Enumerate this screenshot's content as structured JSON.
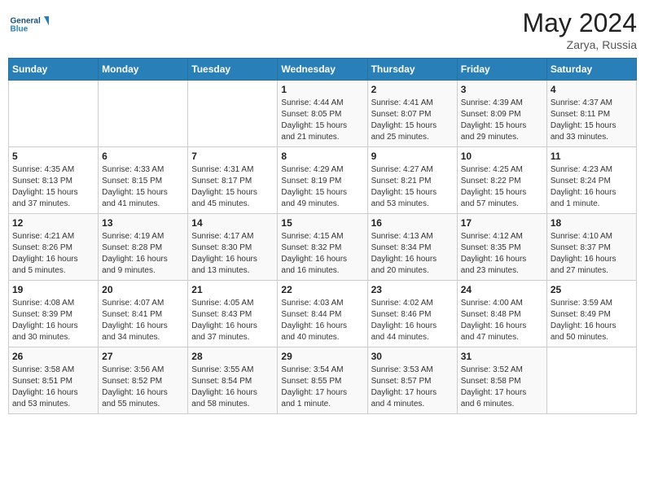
{
  "logo": {
    "line1": "General",
    "line2": "Blue"
  },
  "title": "May 2024",
  "location": "Zarya, Russia",
  "days_header": [
    "Sunday",
    "Monday",
    "Tuesday",
    "Wednesday",
    "Thursday",
    "Friday",
    "Saturday"
  ],
  "weeks": [
    [
      {
        "day": "",
        "info": ""
      },
      {
        "day": "",
        "info": ""
      },
      {
        "day": "",
        "info": ""
      },
      {
        "day": "1",
        "info": "Sunrise: 4:44 AM\nSunset: 8:05 PM\nDaylight: 15 hours\nand 21 minutes."
      },
      {
        "day": "2",
        "info": "Sunrise: 4:41 AM\nSunset: 8:07 PM\nDaylight: 15 hours\nand 25 minutes."
      },
      {
        "day": "3",
        "info": "Sunrise: 4:39 AM\nSunset: 8:09 PM\nDaylight: 15 hours\nand 29 minutes."
      },
      {
        "day": "4",
        "info": "Sunrise: 4:37 AM\nSunset: 8:11 PM\nDaylight: 15 hours\nand 33 minutes."
      }
    ],
    [
      {
        "day": "5",
        "info": "Sunrise: 4:35 AM\nSunset: 8:13 PM\nDaylight: 15 hours\nand 37 minutes."
      },
      {
        "day": "6",
        "info": "Sunrise: 4:33 AM\nSunset: 8:15 PM\nDaylight: 15 hours\nand 41 minutes."
      },
      {
        "day": "7",
        "info": "Sunrise: 4:31 AM\nSunset: 8:17 PM\nDaylight: 15 hours\nand 45 minutes."
      },
      {
        "day": "8",
        "info": "Sunrise: 4:29 AM\nSunset: 8:19 PM\nDaylight: 15 hours\nand 49 minutes."
      },
      {
        "day": "9",
        "info": "Sunrise: 4:27 AM\nSunset: 8:21 PM\nDaylight: 15 hours\nand 53 minutes."
      },
      {
        "day": "10",
        "info": "Sunrise: 4:25 AM\nSunset: 8:22 PM\nDaylight: 15 hours\nand 57 minutes."
      },
      {
        "day": "11",
        "info": "Sunrise: 4:23 AM\nSunset: 8:24 PM\nDaylight: 16 hours\nand 1 minute."
      }
    ],
    [
      {
        "day": "12",
        "info": "Sunrise: 4:21 AM\nSunset: 8:26 PM\nDaylight: 16 hours\nand 5 minutes."
      },
      {
        "day": "13",
        "info": "Sunrise: 4:19 AM\nSunset: 8:28 PM\nDaylight: 16 hours\nand 9 minutes."
      },
      {
        "day": "14",
        "info": "Sunrise: 4:17 AM\nSunset: 8:30 PM\nDaylight: 16 hours\nand 13 minutes."
      },
      {
        "day": "15",
        "info": "Sunrise: 4:15 AM\nSunset: 8:32 PM\nDaylight: 16 hours\nand 16 minutes."
      },
      {
        "day": "16",
        "info": "Sunrise: 4:13 AM\nSunset: 8:34 PM\nDaylight: 16 hours\nand 20 minutes."
      },
      {
        "day": "17",
        "info": "Sunrise: 4:12 AM\nSunset: 8:35 PM\nDaylight: 16 hours\nand 23 minutes."
      },
      {
        "day": "18",
        "info": "Sunrise: 4:10 AM\nSunset: 8:37 PM\nDaylight: 16 hours\nand 27 minutes."
      }
    ],
    [
      {
        "day": "19",
        "info": "Sunrise: 4:08 AM\nSunset: 8:39 PM\nDaylight: 16 hours\nand 30 minutes."
      },
      {
        "day": "20",
        "info": "Sunrise: 4:07 AM\nSunset: 8:41 PM\nDaylight: 16 hours\nand 34 minutes."
      },
      {
        "day": "21",
        "info": "Sunrise: 4:05 AM\nSunset: 8:43 PM\nDaylight: 16 hours\nand 37 minutes."
      },
      {
        "day": "22",
        "info": "Sunrise: 4:03 AM\nSunset: 8:44 PM\nDaylight: 16 hours\nand 40 minutes."
      },
      {
        "day": "23",
        "info": "Sunrise: 4:02 AM\nSunset: 8:46 PM\nDaylight: 16 hours\nand 44 minutes."
      },
      {
        "day": "24",
        "info": "Sunrise: 4:00 AM\nSunset: 8:48 PM\nDaylight: 16 hours\nand 47 minutes."
      },
      {
        "day": "25",
        "info": "Sunrise: 3:59 AM\nSunset: 8:49 PM\nDaylight: 16 hours\nand 50 minutes."
      }
    ],
    [
      {
        "day": "26",
        "info": "Sunrise: 3:58 AM\nSunset: 8:51 PM\nDaylight: 16 hours\nand 53 minutes."
      },
      {
        "day": "27",
        "info": "Sunrise: 3:56 AM\nSunset: 8:52 PM\nDaylight: 16 hours\nand 55 minutes."
      },
      {
        "day": "28",
        "info": "Sunrise: 3:55 AM\nSunset: 8:54 PM\nDaylight: 16 hours\nand 58 minutes."
      },
      {
        "day": "29",
        "info": "Sunrise: 3:54 AM\nSunset: 8:55 PM\nDaylight: 17 hours\nand 1 minute."
      },
      {
        "day": "30",
        "info": "Sunrise: 3:53 AM\nSunset: 8:57 PM\nDaylight: 17 hours\nand 4 minutes."
      },
      {
        "day": "31",
        "info": "Sunrise: 3:52 AM\nSunset: 8:58 PM\nDaylight: 17 hours\nand 6 minutes."
      },
      {
        "day": "",
        "info": ""
      }
    ]
  ]
}
